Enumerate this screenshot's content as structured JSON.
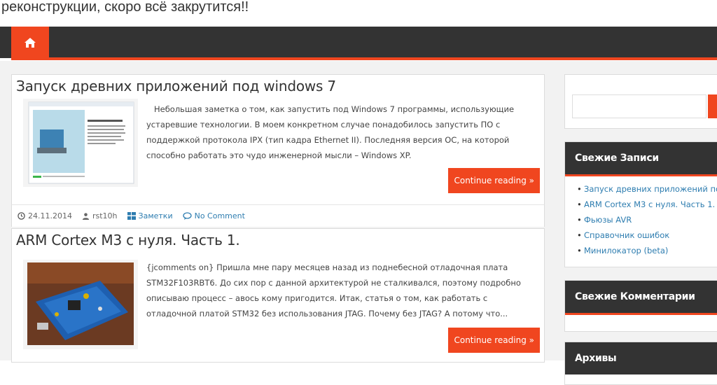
{
  "site": {
    "tagline": "реконструкции, скоро всё закрутится!!"
  },
  "nav": {
    "home_icon": "home-icon"
  },
  "posts": [
    {
      "title": "Запуск древних приложений под windows 7",
      "excerpt": "Небольшая заметка о том, как запустить под Windows 7 программы, использующие устаревшие технологии. В моем конкретном случае понадобилось запустить ПО с поддержкой протокола IPX (тип кадра Ethernet II). Последняя версия ОС, на которой способно работать это чудо инженерной мысли – Windows XP.",
      "read_more": "Continue reading »",
      "date": "24.11.2014",
      "author": "rst10h",
      "category": "Заметки",
      "comments": "No Comment"
    },
    {
      "title": "ARM Cortex M3 с нуля. Часть 1.",
      "excerpt": "{jcomments on}           Пришла мне пару месяцев назад из поднебесной отладочная плата STM32F103RBT6. До сих пор с данной архитектурой не сталкивался, поэтому подробно описываю процесс – авось кому пригодится. Итак, статья о том, как работать с отладочной платой STM32 без использования JTAG. Почему без JTAG? А потому что...",
      "read_more": "Continue reading »"
    }
  ],
  "sidebar": {
    "recent_title": "Свежие Записи",
    "recent_items": [
      "Запуск древних приложений под",
      "ARM Cortex M3 с нуля. Часть 1.",
      "Фьюзы AVR",
      "Справочник ошибок",
      "Минилокатор (beta)"
    ],
    "comments_title": "Свежие Комментарии",
    "archives_title": "Архивы"
  },
  "colors": {
    "accent": "#f0461f",
    "dark": "#333333",
    "link": "#2e7db0"
  }
}
